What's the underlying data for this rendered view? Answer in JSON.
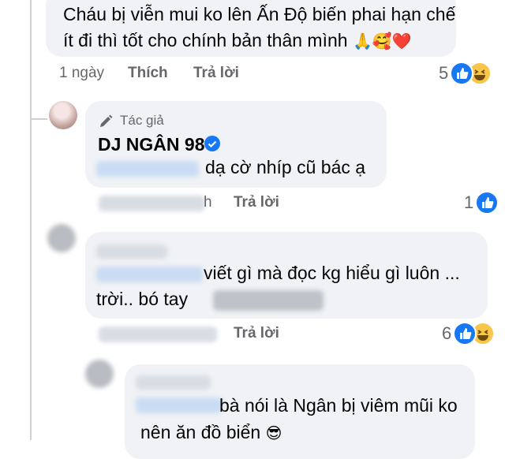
{
  "comment1": {
    "line1": "Cháu bị viễn mui ko lên Ấn Độ biến phai hạn chế",
    "line2": "ít đi thì tốt cho chính bản thân mình",
    "emoji": "🙏🥰❤️",
    "time": "1 ngày",
    "like": "Thích",
    "reply": "Trả lời",
    "reaction_count": "5"
  },
  "comment2": {
    "badge": "Tác giả",
    "author": "DJ NGÂN 98",
    "text": "dạ cờ nhíp cũ bác ạ",
    "time_partial": "h",
    "reply": "Trả lời",
    "reaction_count": "1"
  },
  "comment3": {
    "line1": "viết gì mà đọc kg hiểu gì luôn ...",
    "line2": "trời.. bó tay",
    "reply": "Trả lời",
    "reaction_count": "6"
  },
  "comment4": {
    "line1": "bà nói là Ngân bị viêm mũi ko",
    "line2": "nên ăn đồ biển",
    "emoji": "😎"
  },
  "icons": {
    "pen": "pen-icon",
    "verified": "verified-badge-icon",
    "like": "like-reaction-icon",
    "haha": "haha-reaction-icon"
  },
  "colors": {
    "bubble": "#f0f2f5",
    "meta_text": "#65676b",
    "like_blue": "#1877f2",
    "verified_blue": "#1877f2"
  }
}
